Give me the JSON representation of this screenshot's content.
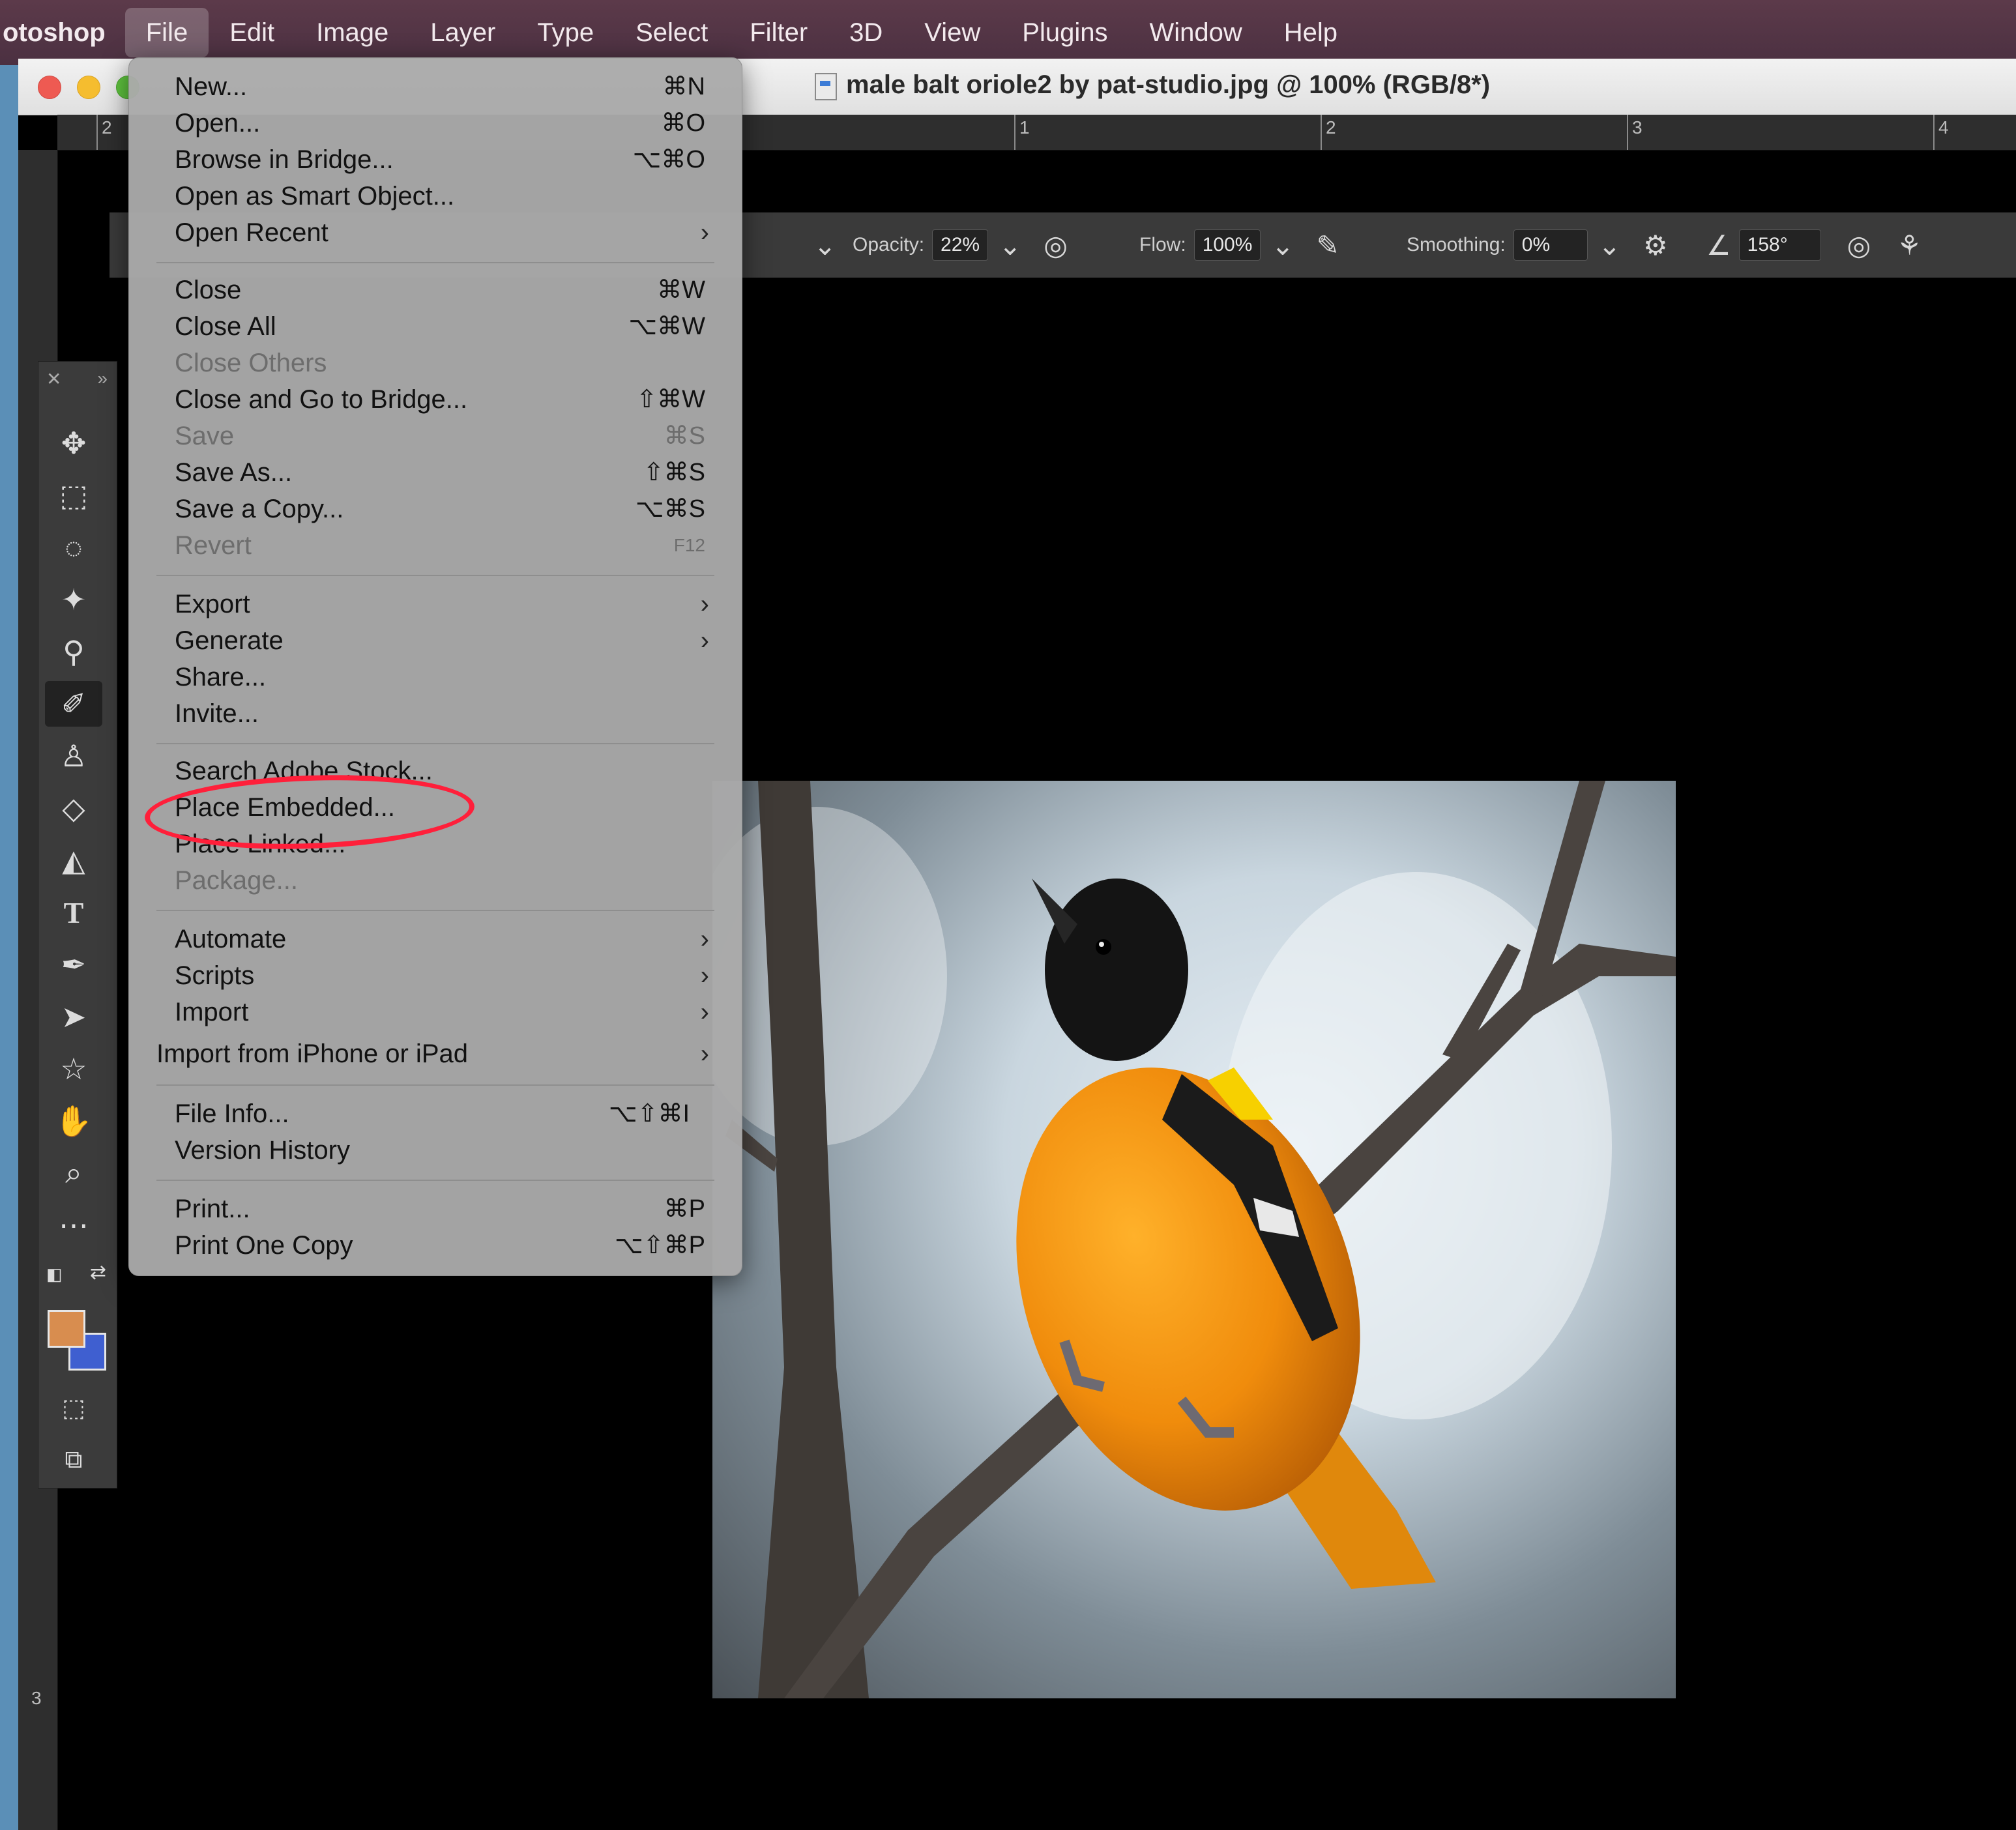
{
  "menubar": {
    "app": "otoshop",
    "items": [
      "File",
      "Edit",
      "Image",
      "Layer",
      "Type",
      "Select",
      "Filter",
      "3D",
      "View",
      "Plugins",
      "Window",
      "Help"
    ]
  },
  "document": {
    "title": "male balt oriole2 by pat-studio.jpg @ 100% (RGB/8*)"
  },
  "rulers": {
    "top_labels": [
      "2",
      "1",
      "2",
      "3",
      "4"
    ],
    "left_labels": [
      "3"
    ]
  },
  "options_bar": {
    "opacity_label": "Opacity:",
    "opacity_value": "22%",
    "flow_label": "Flow:",
    "flow_value": "100%",
    "smoothing_label": "Smoothing:",
    "smoothing_value": "0%",
    "angle_value": "158°"
  },
  "colors": {
    "foreground": "#d88d4f",
    "background": "#3f5fd0",
    "highlight": "#ff1f3a"
  },
  "file_menu": {
    "items": [
      {
        "label": "New...",
        "shortcut": "⌘N"
      },
      {
        "label": "Open...",
        "shortcut": "⌘O"
      },
      {
        "label": "Browse in Bridge...",
        "shortcut": "⌥⌘O"
      },
      {
        "label": "Open as Smart Object...",
        "shortcut": ""
      },
      {
        "label": "Open Recent",
        "shortcut": ""
      },
      {
        "label": "Close",
        "shortcut": "⌘W"
      },
      {
        "label": "Close All",
        "shortcut": "⌥⌘W"
      },
      {
        "label": "Close Others",
        "shortcut": ""
      },
      {
        "label": "Close and Go to Bridge...",
        "shortcut": "⇧⌘W"
      },
      {
        "label": "Save",
        "shortcut": "⌘S"
      },
      {
        "label": "Save As...",
        "shortcut": "⇧⌘S"
      },
      {
        "label": "Save a Copy...",
        "shortcut": "⌥⌘S"
      },
      {
        "label": "Revert",
        "shortcut": "F12"
      },
      {
        "label": "Export",
        "shortcut": ""
      },
      {
        "label": "Generate",
        "shortcut": ""
      },
      {
        "label": "Share...",
        "shortcut": ""
      },
      {
        "label": "Invite...",
        "shortcut": ""
      },
      {
        "label": "Search Adobe Stock...",
        "shortcut": ""
      },
      {
        "label": "Place Embedded...",
        "shortcut": ""
      },
      {
        "label": "Place Linked...",
        "shortcut": ""
      },
      {
        "label": "Package...",
        "shortcut": ""
      },
      {
        "label": "Automate",
        "shortcut": ""
      },
      {
        "label": "Scripts",
        "shortcut": ""
      },
      {
        "label": "Import",
        "shortcut": ""
      },
      {
        "label": "Import from iPhone or iPad",
        "shortcut": ""
      },
      {
        "label": "File Info...",
        "shortcut": "⌥⇧⌘I"
      },
      {
        "label": "Version History",
        "shortcut": ""
      },
      {
        "label": "Print...",
        "shortcut": "⌘P"
      },
      {
        "label": "Print One Copy",
        "shortcut": "⌥⇧⌘P"
      }
    ]
  }
}
